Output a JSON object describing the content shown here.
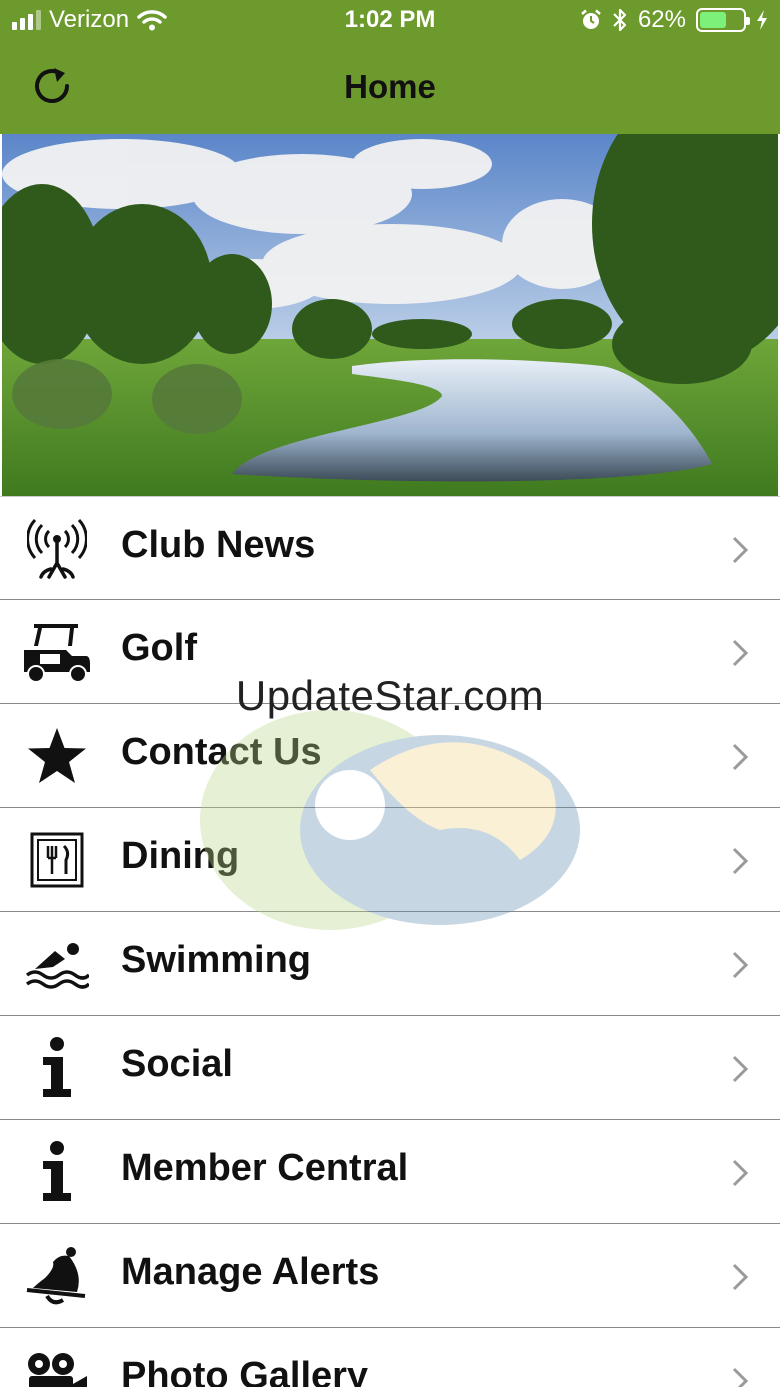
{
  "status_bar": {
    "carrier": "Verizon",
    "time": "1:02 PM",
    "battery_percent": "62%",
    "battery_level": 0.62,
    "icons": [
      "signal-icon",
      "wifi-icon",
      "alarm-icon",
      "bluetooth-icon",
      "battery-icon",
      "charging-icon"
    ]
  },
  "nav": {
    "title": "Home",
    "refresh_icon": "refresh-icon"
  },
  "hero": {
    "image": "golf-course-pond-landscape"
  },
  "menu": {
    "items": [
      {
        "label": "Club News",
        "icon": "antenna-broadcast-icon"
      },
      {
        "label": "Golf",
        "icon": "golf-cart-icon"
      },
      {
        "label": "Contact Us",
        "icon": "star-icon"
      },
      {
        "label": "Dining",
        "icon": "dining-utensils-icon"
      },
      {
        "label": "Swimming",
        "icon": "swimmer-icon"
      },
      {
        "label": "Social",
        "icon": "info-icon"
      },
      {
        "label": "Member Central",
        "icon": "info-icon"
      },
      {
        "label": "Manage Alerts",
        "icon": "bell-icon"
      },
      {
        "label": "Photo Gallery",
        "icon": "video-camera-icon"
      }
    ]
  },
  "watermark": {
    "text": "UpdateStar.com"
  },
  "colors": {
    "header": "#6d9a2c",
    "text": "#111111",
    "divider": "#8a8a8a",
    "chevron": "#9a9a9a"
  }
}
